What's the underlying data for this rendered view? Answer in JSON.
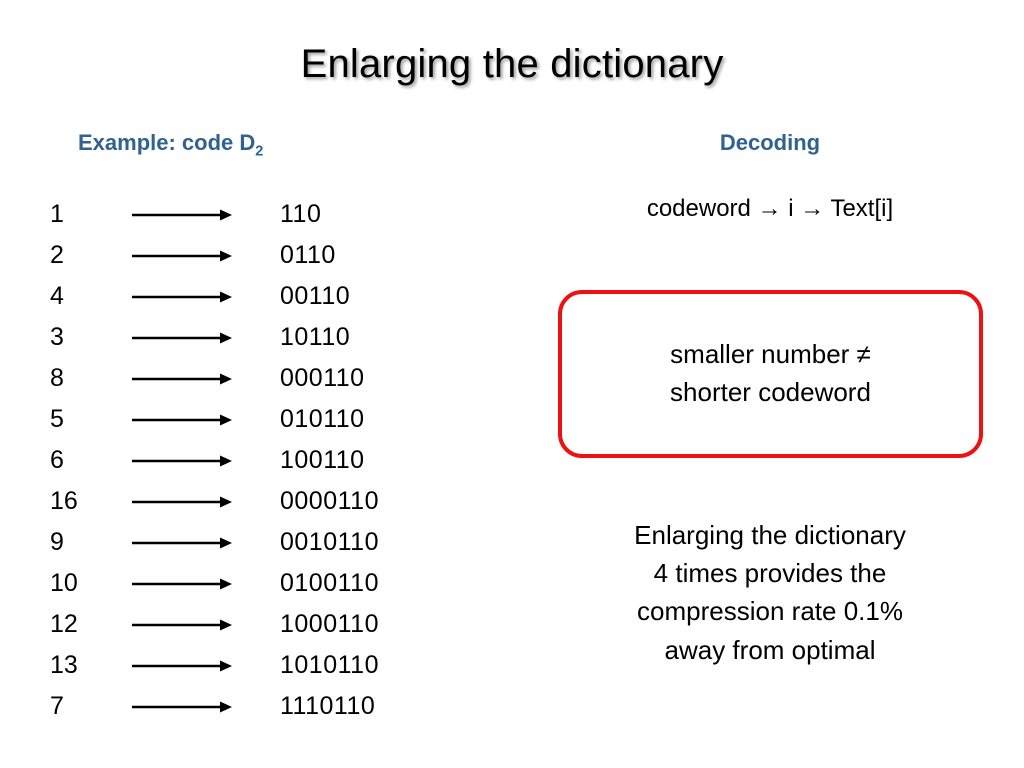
{
  "slide": {
    "title": "Enlarging the dictionary",
    "colors": {
      "heading_blue": "#31628f",
      "callout_red": "#ee1111",
      "text_black": "#000000",
      "background": "#ffffff"
    }
  },
  "left_column": {
    "heading_prefix": "Example: code D",
    "heading_subscript": "2",
    "arrow_icon": "right-arrow-icon",
    "rows": [
      {
        "index": "1",
        "code": "110"
      },
      {
        "index": "2",
        "code": "0110"
      },
      {
        "index": "4",
        "code": "00110"
      },
      {
        "index": "3",
        "code": "10110"
      },
      {
        "index": "8",
        "code": "000110"
      },
      {
        "index": "5",
        "code": "010110"
      },
      {
        "index": "6",
        "code": "100110"
      },
      {
        "index": "16",
        "code": "0000110"
      },
      {
        "index": "9",
        "code": "0010110"
      },
      {
        "index": "10",
        "code": "0100110"
      },
      {
        "index": "12",
        "code": "1000110"
      },
      {
        "index": "13",
        "code": "1010110"
      },
      {
        "index": "7",
        "code": "1110110"
      }
    ]
  },
  "right_column": {
    "heading": "Decoding",
    "formula": "codeword → i → Text[i]",
    "callout": {
      "line1": "smaller number ≠",
      "line2": "shorter codeword"
    },
    "conclusion": {
      "line1": "Enlarging the dictionary",
      "line2": "4 times provides the",
      "line3": "compression rate 0.1%",
      "line4": "away from optimal"
    }
  }
}
